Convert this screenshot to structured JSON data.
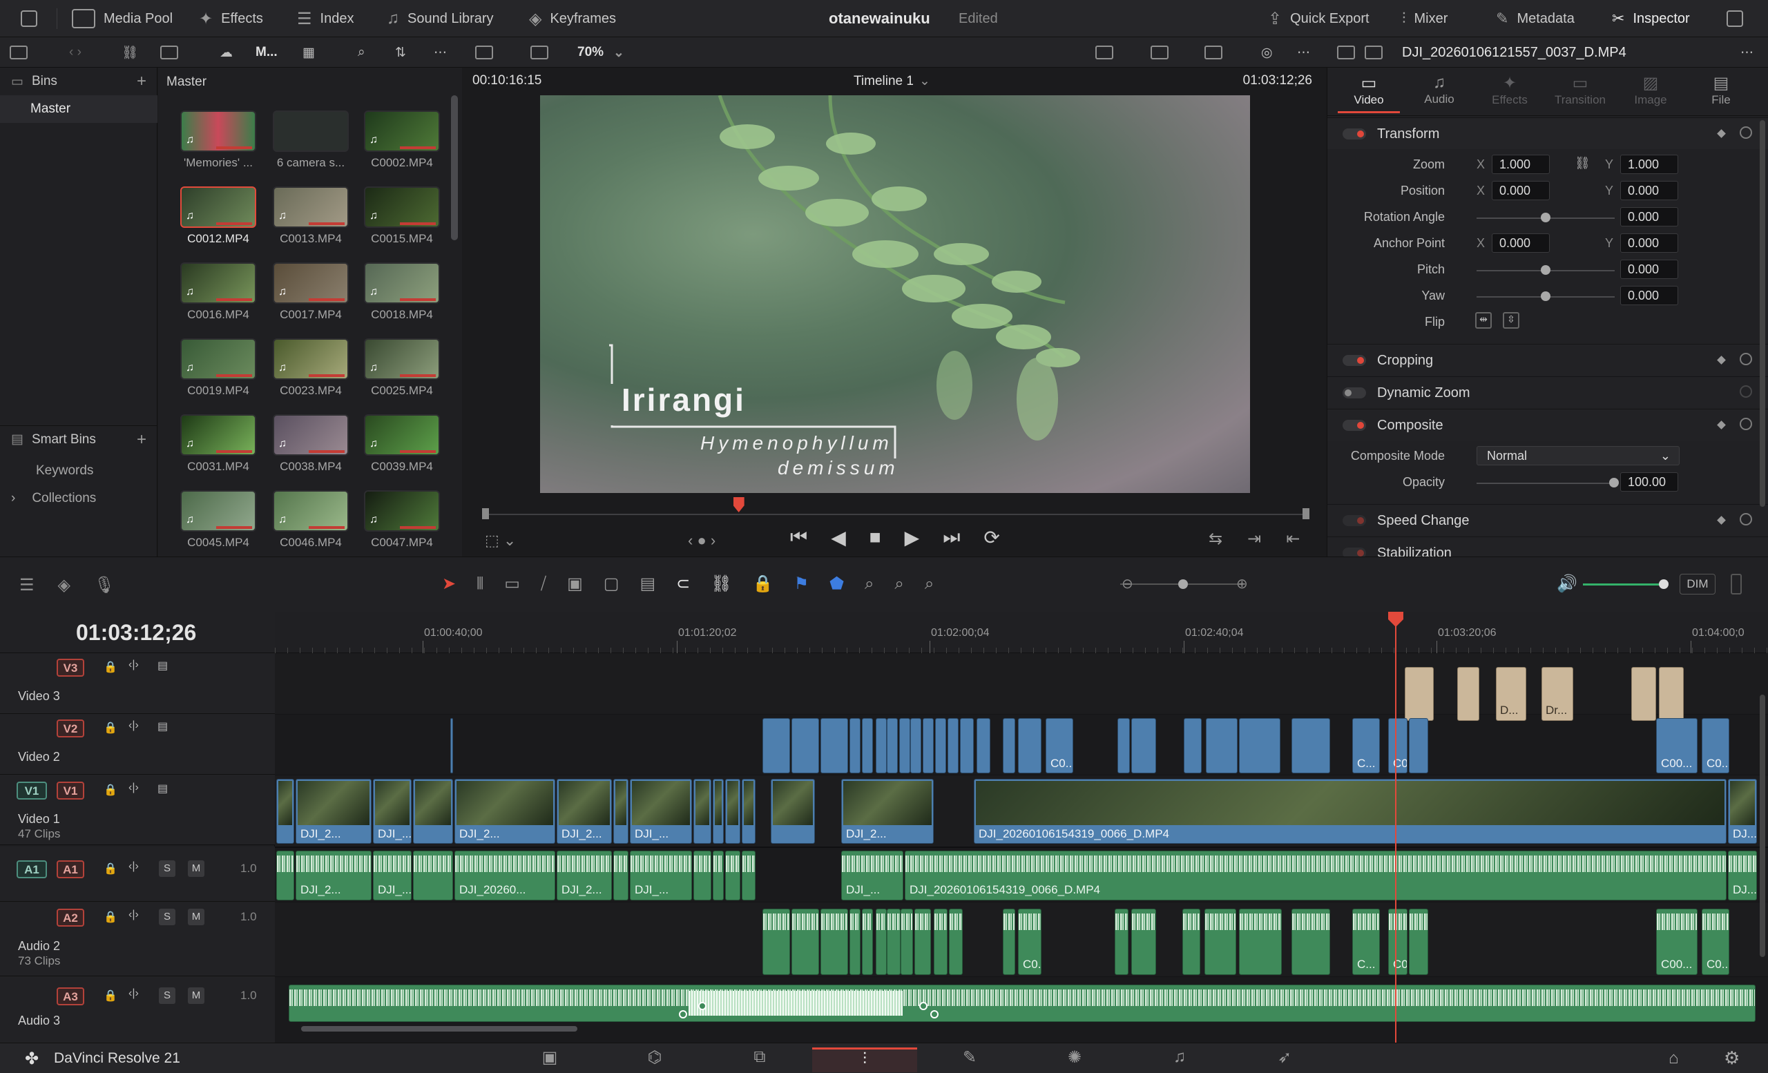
{
  "topbar": {
    "items": [
      "Media Pool",
      "Effects",
      "Index",
      "Sound Library",
      "Keyframes"
    ],
    "project_title": "otanewainuku",
    "project_status": "Edited",
    "right_items": [
      "Quick Export",
      "Mixer",
      "Metadata",
      "Inspector"
    ]
  },
  "toolbar2": {
    "pool_label": "M...",
    "zoom": "70%"
  },
  "bins": {
    "header": "Bins",
    "master": "Master",
    "smart_bins": "Smart Bins",
    "keywords": "Keywords",
    "collections": "Collections"
  },
  "pool": {
    "header": "Master",
    "clips": [
      "'Memories' ...",
      "6 camera s...",
      "C0002.MP4",
      "C0012.MP4",
      "C0013.MP4",
      "C0015.MP4",
      "C0016.MP4",
      "C0017.MP4",
      "C0018.MP4",
      "C0019.MP4",
      "C0023.MP4",
      "C0025.MP4",
      "C0031.MP4",
      "C0038.MP4",
      "C0039.MP4",
      "C0045.MP4",
      "C0046.MP4",
      "C0047.MP4"
    ]
  },
  "viewer": {
    "timecode_left": "00:10:16:15",
    "timeline_name": "Timeline 1",
    "timecode_right": "01:03:12;26",
    "title_main": "Irirangi",
    "title_sub_1": "Hymenophyllum",
    "title_sub_2": "demissum",
    "playhead_fraction": 0.31
  },
  "inspector": {
    "clip_name": "DJI_20260106121557_0037_D.MP4",
    "tabs": [
      "Video",
      "Audio",
      "Effects",
      "Transition",
      "Image",
      "File"
    ],
    "transform": "Transform",
    "zoom_label": "Zoom",
    "zoom_x": "1.000",
    "zoom_y": "1.000",
    "position_label": "Position",
    "position_x": "0.000",
    "position_y": "0.000",
    "rotation_label": "Rotation Angle",
    "rotation": "0.000",
    "anchor_label": "Anchor Point",
    "anchor_x": "0.000",
    "anchor_y": "0.000",
    "pitch_label": "Pitch",
    "pitch": "0.000",
    "yaw_label": "Yaw",
    "yaw": "0.000",
    "flip_label": "Flip",
    "x": "X",
    "y": "Y",
    "cropping": "Cropping",
    "dynamic_zoom": "Dynamic Zoom",
    "composite": "Composite",
    "composite_mode_label": "Composite Mode",
    "composite_mode": "Normal",
    "opacity_label": "Opacity",
    "opacity": "100.00",
    "speed_change": "Speed Change",
    "stabilization": "Stabilization"
  },
  "timeline": {
    "timecode": "01:03:12;26",
    "ruler": [
      "01:00:40;00",
      "01:01:20;02",
      "01:02:00;04",
      "01:02:40;04",
      "01:03:20;06",
      "01:04:00;0"
    ],
    "dim": "DIM",
    "tracks": {
      "v3": {
        "tag": "V3",
        "name": "Video 3"
      },
      "v2": {
        "tag": "V2",
        "name": "Video 2"
      },
      "v1": {
        "src": "V1",
        "tag": "V1",
        "name": "Video 1",
        "count": "47 Clips"
      },
      "a1": {
        "src": "A1",
        "tag": "A1",
        "level": "1.0"
      },
      "a2": {
        "tag": "A2",
        "name": "Audio 2",
        "count": "73 Clips",
        "level": "1.0"
      },
      "a3": {
        "tag": "A3",
        "name": "Audio 3",
        "level": "1.0"
      },
      "solo": "S",
      "mute": "M"
    },
    "v1_clips": [
      "DJI_2...",
      "DJI_...",
      "DJI_2...",
      "DJI_2...",
      "DJI_...",
      "DJI_2...",
      "DJI_20260106154319_0066_D.MP4",
      "DJ..."
    ],
    "a1_clips": [
      "DJI_2...",
      "DJI_...",
      "DJI_20260...",
      "DJI_2...",
      "DJI_...",
      "DJI_...",
      "DJI_20260106154319_0066_D.MP4",
      "DJ..."
    ],
    "v2_caps": [
      "C0...",
      "C...",
      "C0...",
      "C00...",
      "C0..."
    ],
    "v3_caps": [
      "D...",
      "Dr..."
    ]
  },
  "bottom": {
    "app_name": "DaVinci Resolve 21"
  }
}
